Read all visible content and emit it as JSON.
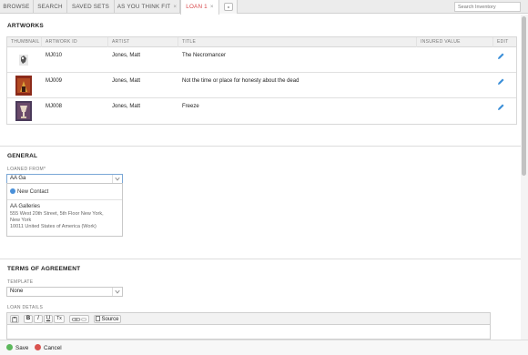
{
  "tabs": [
    {
      "label": "BROWSE"
    },
    {
      "label": "SEARCH"
    },
    {
      "label": "SAVED SETS"
    },
    {
      "label": "AS YOU THINK FIT",
      "close": "×"
    },
    {
      "label": "LOAN 1",
      "close": "×"
    }
  ],
  "search": {
    "placeholder": "Search Inventory"
  },
  "artworks": {
    "heading": "ARTWORKS",
    "columns": [
      "THUMBNAIL",
      "ARTWORK ID",
      "ARTIST",
      "TITLE",
      "INSURED VALUE",
      "EDIT"
    ],
    "rows": [
      {
        "id": "MJ010",
        "artist": "Jones, Matt",
        "title": "The Necromancer",
        "insured": "",
        "thumb_colors": [
          "#e8e8e8",
          "#555555"
        ]
      },
      {
        "id": "MJ009",
        "artist": "Jones, Matt",
        "title": "Not the time or place for honesty about the dead",
        "insured": "",
        "thumb_colors": [
          "#8b2a1a",
          "#d9a23a"
        ]
      },
      {
        "id": "MJ008",
        "artist": "Jones, Matt",
        "title": "Freeze",
        "insured": "",
        "thumb_colors": [
          "#4a3a5a",
          "#e8d8c8"
        ]
      }
    ],
    "edit_icon": "pencil-icon"
  },
  "general": {
    "heading": "GENERAL",
    "loaned_from_label": "LOANED FROM*",
    "loaned_from_value": "AA Ga",
    "dropdown": {
      "new_contact": "New Contact",
      "result_name": "AA Galleries",
      "address_lines": [
        "555 West 20th Street, 5th Floor New York,",
        "New York",
        "10011 United States of America (Work)"
      ]
    }
  },
  "terms": {
    "heading": "TERMS OF AGREEMENT",
    "template_label": "TEMPLATE",
    "template_value": "None",
    "loan_details_label": "LOAN DETAILS",
    "toolbar": {
      "bold": "B",
      "italic": "I",
      "underline": "U",
      "clear": "Tx",
      "source": "Source"
    }
  },
  "footer": {
    "save": "Save",
    "cancel": "Cancel"
  },
  "colors": {
    "accent": "#d8474a",
    "save": "#5cb85c",
    "cancel": "#d9534f",
    "link": "#4a90d9"
  }
}
